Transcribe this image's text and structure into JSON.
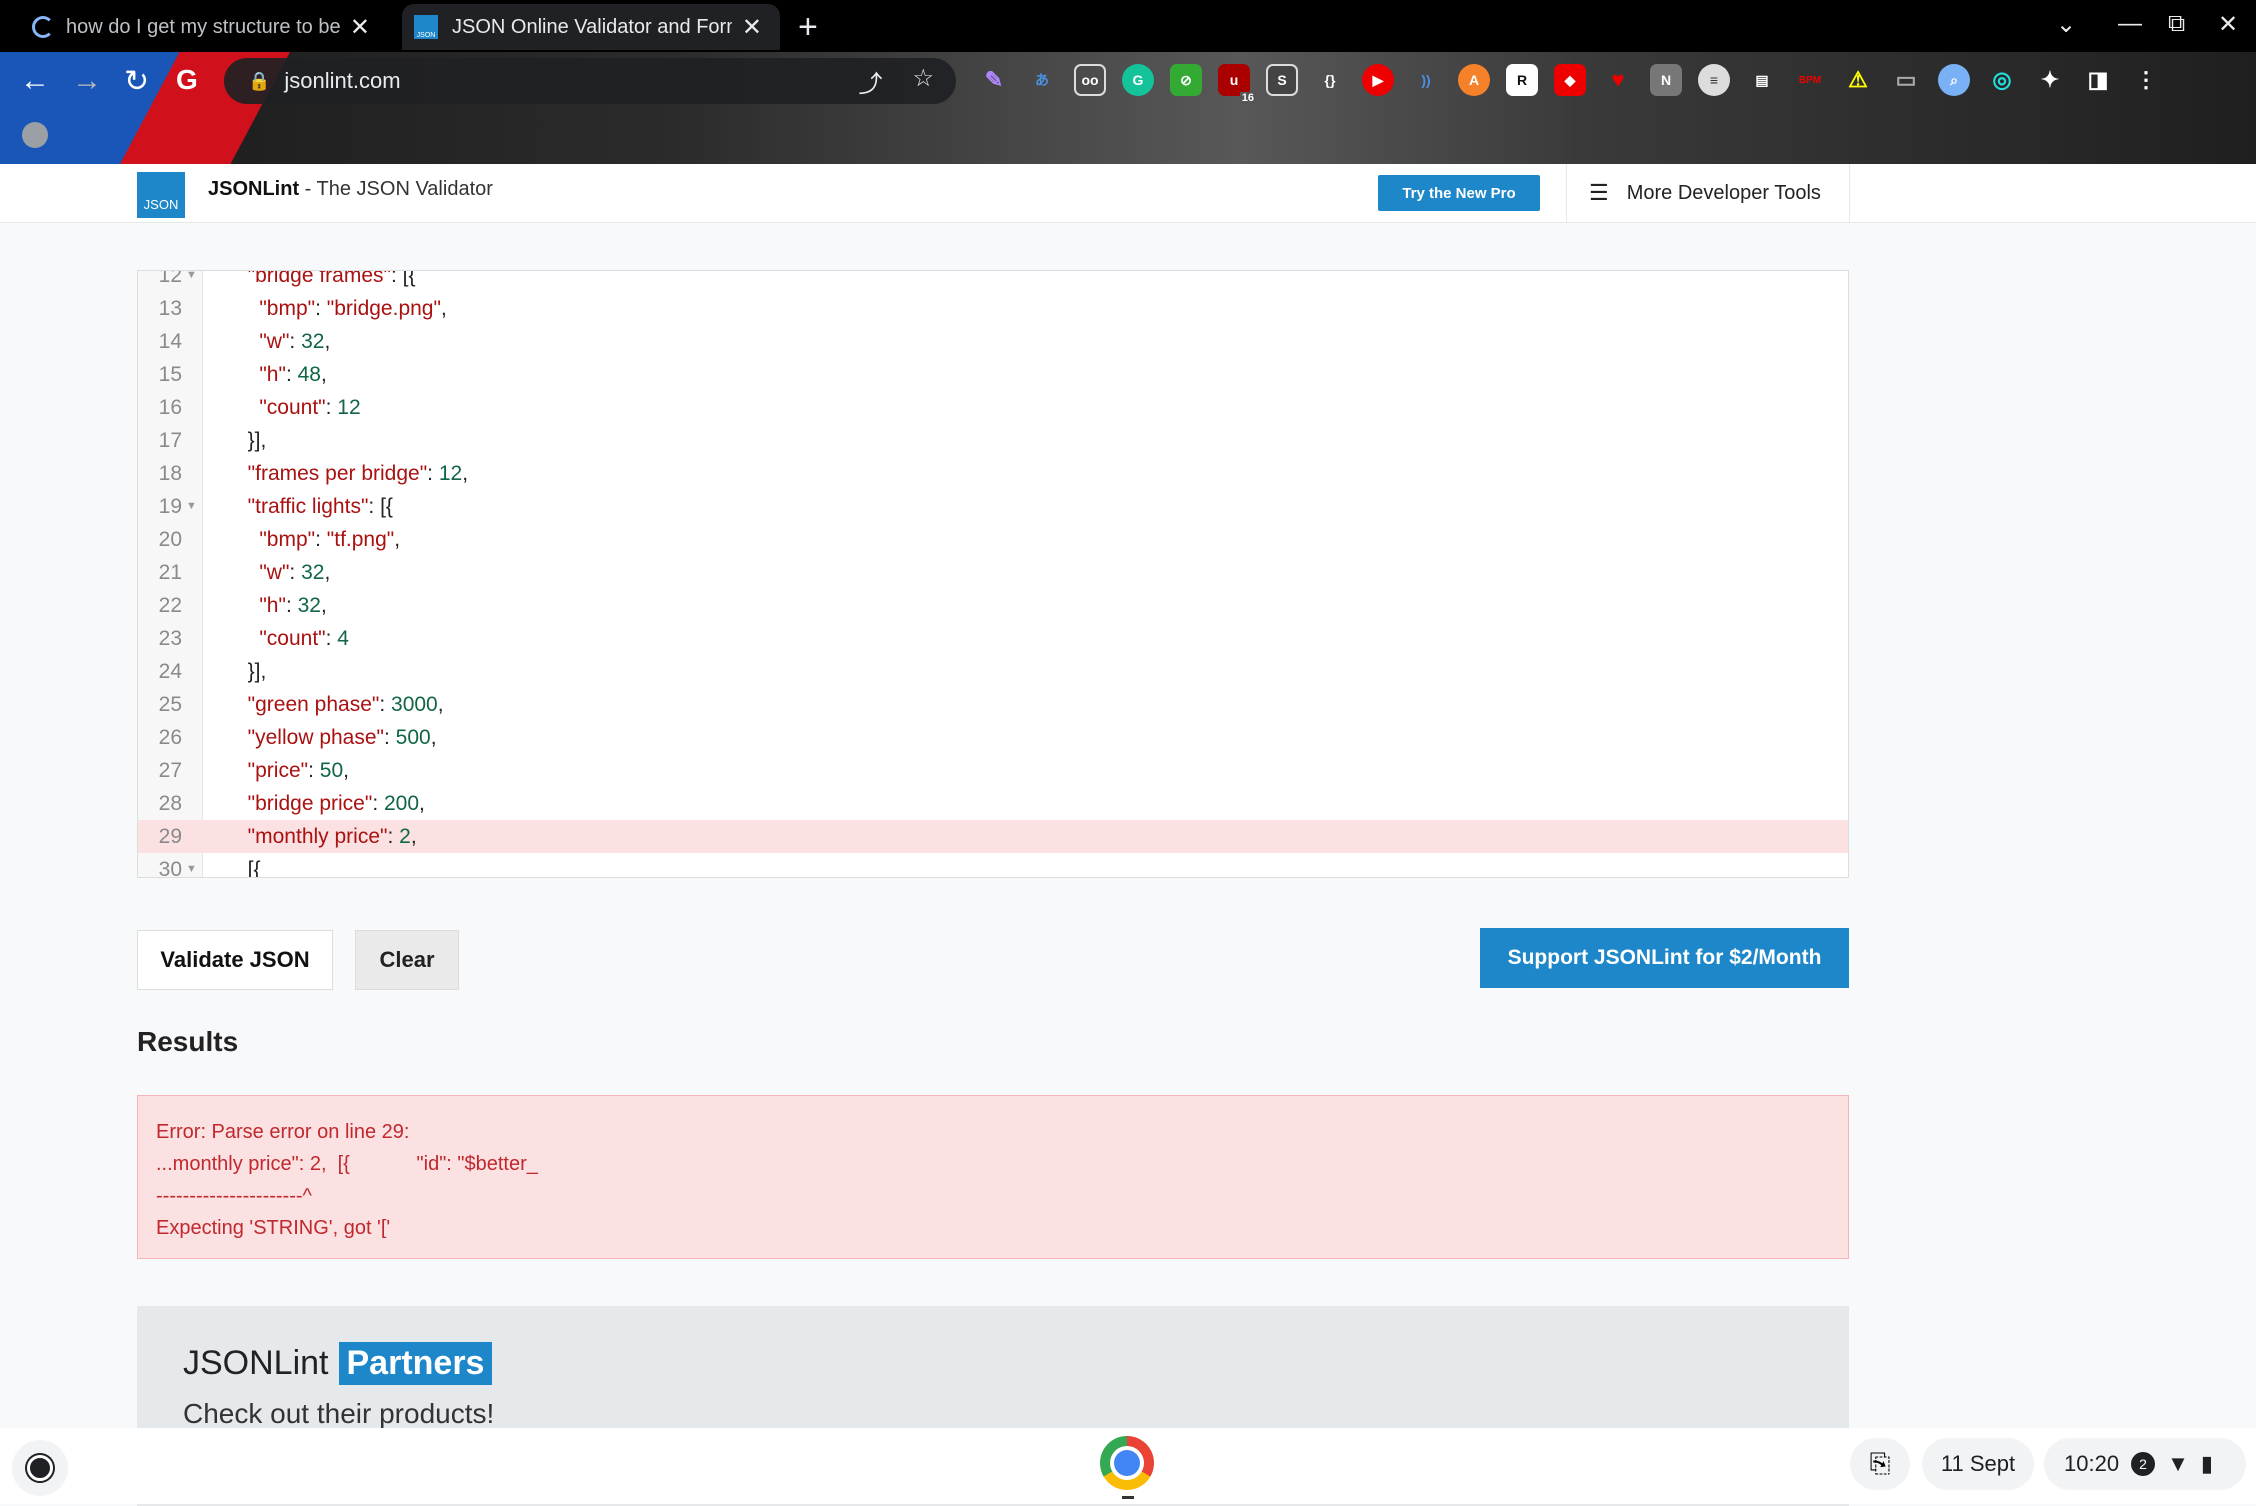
{
  "browser": {
    "tabs": [
      {
        "title": "how do I get my structure to be e"
      },
      {
        "title": "JSON Online Validator and Forma",
        "favicon_text": "JSON"
      }
    ],
    "url": "jsonlint.com",
    "new_tab_glyph": "+",
    "close_glyph": "✕",
    "extension_badge": "16",
    "nav": {
      "back": "←",
      "forward": "→",
      "reload": "↻",
      "google": "G"
    }
  },
  "site": {
    "logo_text": "JSON",
    "title_bold": "JSONLint",
    "title_rest": " - The JSON Validator",
    "try_pro": "Try the New Pro",
    "dev_tools": "More Developer Tools"
  },
  "editor": {
    "lines": [
      {
        "n": "12",
        "fold": true,
        "segs": [
          [
            "s",
            "  \"bridge frames\""
          ],
          [
            "p",
            ": [{"
          ]
        ],
        "partial": "top"
      },
      {
        "n": "13",
        "segs": [
          [
            "p",
            "    "
          ],
          [
            "s",
            "\"bmp\""
          ],
          [
            "p",
            ": "
          ],
          [
            "s",
            "\"bridge.png\""
          ],
          [
            "p",
            ","
          ]
        ]
      },
      {
        "n": "14",
        "segs": [
          [
            "p",
            "    "
          ],
          [
            "s",
            "\"w\""
          ],
          [
            "p",
            ": "
          ],
          [
            "n",
            "32"
          ],
          [
            "p",
            ","
          ]
        ]
      },
      {
        "n": "15",
        "segs": [
          [
            "p",
            "    "
          ],
          [
            "s",
            "\"h\""
          ],
          [
            "p",
            ": "
          ],
          [
            "n",
            "48"
          ],
          [
            "p",
            ","
          ]
        ]
      },
      {
        "n": "16",
        "segs": [
          [
            "p",
            "    "
          ],
          [
            "s",
            "\"count\""
          ],
          [
            "p",
            ": "
          ],
          [
            "n",
            "12"
          ]
        ]
      },
      {
        "n": "17",
        "segs": [
          [
            "p",
            "  }],"
          ]
        ]
      },
      {
        "n": "18",
        "segs": [
          [
            "p",
            "  "
          ],
          [
            "s",
            "\"frames per bridge\""
          ],
          [
            "p",
            ": "
          ],
          [
            "n",
            "12"
          ],
          [
            "p",
            ","
          ]
        ]
      },
      {
        "n": "19",
        "fold": true,
        "segs": [
          [
            "p",
            "  "
          ],
          [
            "s",
            "\"traffic lights\""
          ],
          [
            "p",
            ": [{"
          ]
        ]
      },
      {
        "n": "20",
        "segs": [
          [
            "p",
            "    "
          ],
          [
            "s",
            "\"bmp\""
          ],
          [
            "p",
            ": "
          ],
          [
            "s",
            "\"tf.png\""
          ],
          [
            "p",
            ","
          ]
        ]
      },
      {
        "n": "21",
        "segs": [
          [
            "p",
            "    "
          ],
          [
            "s",
            "\"w\""
          ],
          [
            "p",
            ": "
          ],
          [
            "n",
            "32"
          ],
          [
            "p",
            ","
          ]
        ]
      },
      {
        "n": "22",
        "segs": [
          [
            "p",
            "    "
          ],
          [
            "s",
            "\"h\""
          ],
          [
            "p",
            ": "
          ],
          [
            "n",
            "32"
          ],
          [
            "p",
            ","
          ]
        ]
      },
      {
        "n": "23",
        "segs": [
          [
            "p",
            "    "
          ],
          [
            "s",
            "\"count\""
          ],
          [
            "p",
            ": "
          ],
          [
            "n",
            "4"
          ]
        ]
      },
      {
        "n": "24",
        "segs": [
          [
            "p",
            "  }],"
          ]
        ]
      },
      {
        "n": "25",
        "segs": [
          [
            "p",
            "  "
          ],
          [
            "s",
            "\"green phase\""
          ],
          [
            "p",
            ": "
          ],
          [
            "n",
            "3000"
          ],
          [
            "p",
            ","
          ]
        ]
      },
      {
        "n": "26",
        "segs": [
          [
            "p",
            "  "
          ],
          [
            "s",
            "\"yellow phase\""
          ],
          [
            "p",
            ": "
          ],
          [
            "n",
            "500"
          ],
          [
            "p",
            ","
          ]
        ]
      },
      {
        "n": "27",
        "segs": [
          [
            "p",
            "  "
          ],
          [
            "s",
            "\"price\""
          ],
          [
            "p",
            ": "
          ],
          [
            "n",
            "50"
          ],
          [
            "p",
            ","
          ]
        ]
      },
      {
        "n": "28",
        "segs": [
          [
            "p",
            "  "
          ],
          [
            "s",
            "\"bridge price\""
          ],
          [
            "p",
            ": "
          ],
          [
            "n",
            "200"
          ],
          [
            "p",
            ","
          ]
        ]
      },
      {
        "n": "29",
        "highlight": true,
        "segs": [
          [
            "p",
            "  "
          ],
          [
            "s",
            "\"monthly price\""
          ],
          [
            "p",
            ": "
          ],
          [
            "n",
            "2"
          ],
          [
            "p",
            ","
          ]
        ]
      },
      {
        "n": "30",
        "fold": true,
        "segs": [
          [
            "p",
            "  [{"
          ]
        ],
        "partial": "bottom"
      }
    ]
  },
  "buttons": {
    "validate": "Validate JSON",
    "clear": "Clear",
    "support": "Support JSONLint for $2/Month"
  },
  "results": {
    "title": "Results",
    "error_lines": [
      "Error: Parse error on line 29:",
      "...monthly price\": 2,  [{            \"id\": \"$better_",
      "----------------------^",
      "Expecting 'STRING', got '['"
    ]
  },
  "partners": {
    "title": "JSONLint",
    "badge": "Partners",
    "subtitle": "Check out their products!"
  },
  "shelf": {
    "date": "11 Sept",
    "time": "10:20",
    "notification_count": "2"
  },
  "colors": {
    "accent": "#1d87c9",
    "error_bg": "#fbe1e2",
    "error_text": "#c0282d",
    "string": "#aa1111",
    "number": "#116644"
  }
}
